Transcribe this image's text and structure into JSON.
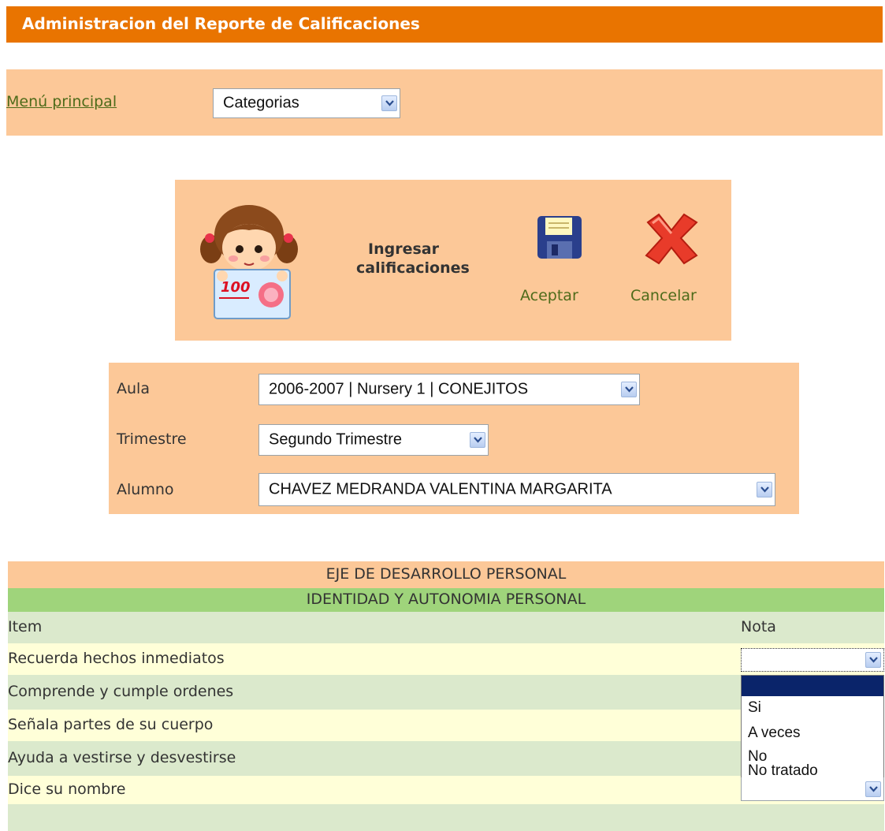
{
  "header": {
    "title": "Administracion del Reporte de Calificaciones"
  },
  "menu": {
    "link_label": "Menú principal",
    "category_select": {
      "value": "Categorias"
    }
  },
  "panel": {
    "title_line1": "Ingresar",
    "title_line2": "calificaciones",
    "accept_label": "Aceptar",
    "cancel_label": "Cancelar"
  },
  "filters": {
    "aula": {
      "label": "Aula",
      "value": "2006-2007 | Nursery 1 | CONEJITOS"
    },
    "trimestre": {
      "label": "Trimestre",
      "value": "Segundo Trimestre"
    },
    "alumno": {
      "label": "Alumno",
      "value": "CHAVEZ MEDRANDA VALENTINA MARGARITA"
    }
  },
  "table": {
    "section_header": "EJE DE DESARROLLO PERSONAL",
    "subsection_header": "IDENTIDAD Y AUTONOMIA PERSONAL",
    "columns": {
      "item": "Item",
      "nota": "Nota"
    },
    "rows": [
      {
        "item": "Recuerda hechos inmediatos",
        "nota": ""
      },
      {
        "item": "Comprende y cumple ordenes",
        "nota": ""
      },
      {
        "item": "Señala partes de su cuerpo",
        "nota": ""
      },
      {
        "item": "Ayuda a vestirse y desvestirse",
        "nota": ""
      },
      {
        "item": "Dice su nombre",
        "nota": ""
      }
    ]
  },
  "nota_dropdown": {
    "options": [
      "",
      "Si",
      "A veces",
      "No",
      "No tratado"
    ]
  },
  "colors": {
    "title_bar": "#e97400",
    "panel_bg": "#fcc898",
    "section_green": "#9fd47b",
    "row_yellow": "#ffffd8",
    "row_green": "#dbe9cc",
    "link_green": "#4e6b1a",
    "highlight_blue": "#0a246a"
  },
  "icons": [
    "girl-mascot-icon",
    "floppy-disk-icon",
    "red-x-icon",
    "chevron-down-icon"
  ]
}
